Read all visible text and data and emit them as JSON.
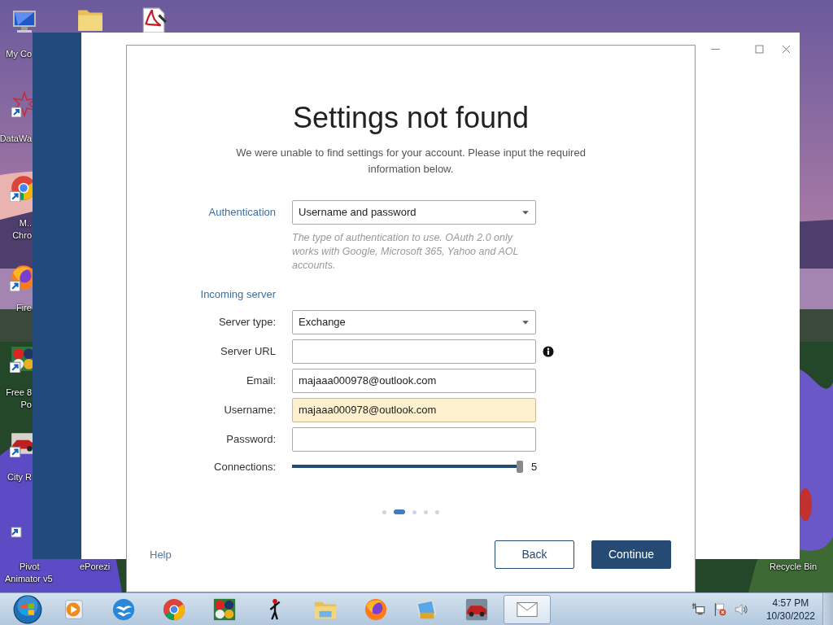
{
  "desktop": {
    "icons": [
      {
        "kind": "computer",
        "lines": [
          "My Co"
        ]
      },
      {
        "kind": "folder"
      },
      {
        "kind": "document-tool"
      },
      {
        "kind": "flower",
        "lines": [
          "DataWa"
        ]
      },
      {
        "kind": "browser",
        "lines": [
          "M..",
          "Chro"
        ]
      },
      {
        "kind": "firefox",
        "lines": [
          "Fire"
        ]
      },
      {
        "kind": "balls",
        "lines": [
          "Free 8",
          "Po"
        ]
      },
      {
        "kind": "car",
        "lines": [
          "City R"
        ]
      },
      {
        "kind": "shortcut",
        "lines": [
          "Pivot",
          "Animator v5"
        ]
      },
      {
        "lines": [
          "ePorezi"
        ]
      },
      {
        "lines": [
          "Recycle Bin"
        ]
      }
    ]
  },
  "dialog": {
    "title": "Settings not found",
    "subtitle": "We were unable to find settings for your account. Please input the required information below.",
    "authentication": {
      "label": "Authentication",
      "value": "Username and password",
      "hint": "The type of authentication to use. OAuth 2.0 only works with Google, Microsoft 365, Yahoo and AOL accounts."
    },
    "section": "Incoming server",
    "fields": [
      {
        "label": "Server type:",
        "kind": "select",
        "value": "Exchange"
      },
      {
        "label": "Server URL",
        "kind": "input",
        "info": true
      },
      {
        "label": "Email:",
        "kind": "input",
        "value": "majaaa000978@outlook.com"
      },
      {
        "label": "Username:",
        "kind": "input",
        "value": "majaaa000978@outlook.com",
        "highlighted": true
      },
      {
        "label": "Password:",
        "kind": "password"
      },
      {
        "label": "Connections:",
        "kind": "slider",
        "level": 1,
        "reading": "5"
      }
    ],
    "pager": [
      {
        "selected": false
      },
      {
        "selected": true
      },
      {
        "selected": false
      },
      {
        "selected": false
      },
      {
        "selected": false
      }
    ],
    "help": "Help",
    "buttons": [
      {
        "label": "Back",
        "kind": "secondary"
      },
      {
        "label": "Continue",
        "kind": "primary"
      }
    ]
  },
  "taskbar": {
    "items": [
      {
        "kind": "player",
        "selected": false
      },
      {
        "kind": "office",
        "selected": false
      },
      {
        "kind": "browser",
        "selected": false
      },
      {
        "kind": "balls",
        "selected": false
      },
      {
        "kind": "stick-figure",
        "selected": false
      },
      {
        "kind": "explorer",
        "selected": false
      },
      {
        "kind": "firefox",
        "selected": false
      },
      {
        "kind": "picture-tool",
        "selected": false
      },
      {
        "kind": "car",
        "selected": false
      },
      {
        "kind": "mail",
        "selected": true
      }
    ],
    "clock": {
      "time": "4:57 PM",
      "date": "10/30/2022"
    }
  }
}
